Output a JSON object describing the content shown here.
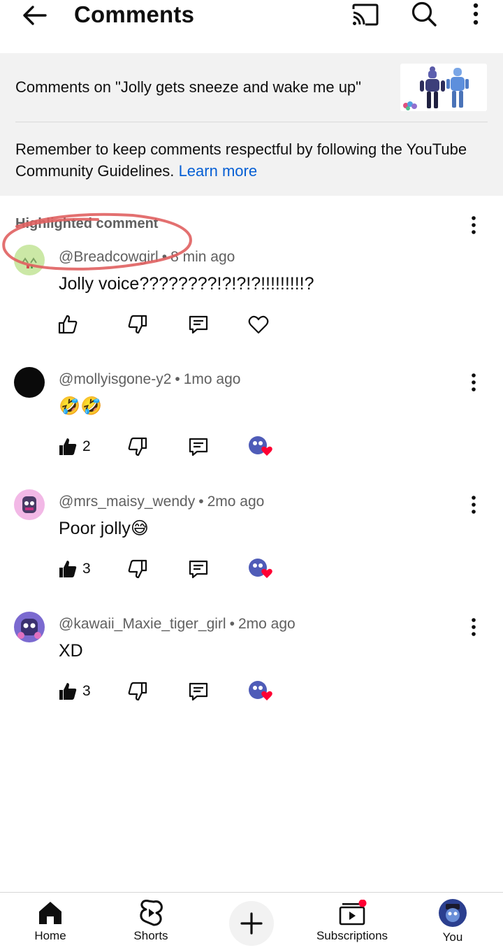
{
  "header": {
    "title": "Comments",
    "icons": {
      "back": "arrow-left",
      "cast": "cast",
      "search": "search",
      "more": "more-vertical"
    }
  },
  "video": {
    "title": "Comments on \"Jolly gets sneeze and wake me up\"",
    "guidelines_text": "Remember to keep comments respectful by following the YouTube Community Guidelines.",
    "learn_more": "Learn more"
  },
  "comments": {
    "highlight_label": "Highlighted comment",
    "items": [
      {
        "author": "@Breadcowgirl",
        "time": "8 min ago",
        "text": "Jolly voice????????!?!?!?!!!!!!!!!?",
        "likes": "",
        "creator_heart": false,
        "avatar_color": "#c8e6a0",
        "liked_outline": true
      },
      {
        "author": "@mollyisgone-y2",
        "time": "1mo ago",
        "text": "🤣🤣",
        "likes": "2",
        "creator_heart": true,
        "avatar_color": "#0a0a0a"
      },
      {
        "author": "@mrs_maisy_wendy",
        "time": "2mo ago",
        "text": "Poor jolly😅",
        "likes": "3",
        "creator_heart": true,
        "avatar_color": "#f0b0e0"
      },
      {
        "author": "@kawaii_Maxie_tiger_girl",
        "time": "2mo ago",
        "text": "XD",
        "likes": "3",
        "creator_heart": true,
        "avatar_color": "#6a5acd"
      }
    ]
  },
  "bottom_nav": {
    "home": "Home",
    "shorts": "Shorts",
    "subscriptions": "Subscriptions",
    "you": "You"
  },
  "colors": {
    "link": "#065fd4",
    "panel_bg": "#f2f2f2",
    "heart": "#ff0033",
    "annotation": "#e06060"
  }
}
